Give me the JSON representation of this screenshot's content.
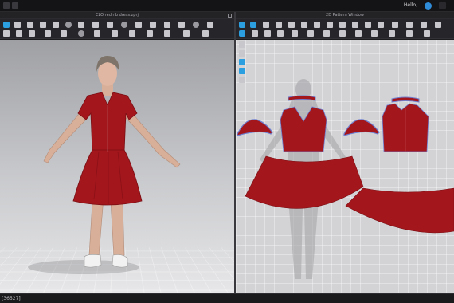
{
  "topbar": {
    "greeting": "Hello,"
  },
  "windows": {
    "left_title": "CLO red rib dress.zprj",
    "right_title": "2D Pattern Window"
  },
  "status": {
    "text": "[36527]"
  },
  "colors": {
    "dress": "#a3161c",
    "pattern_trim": "#6f7fd0",
    "accent": "#2b9fe0"
  }
}
